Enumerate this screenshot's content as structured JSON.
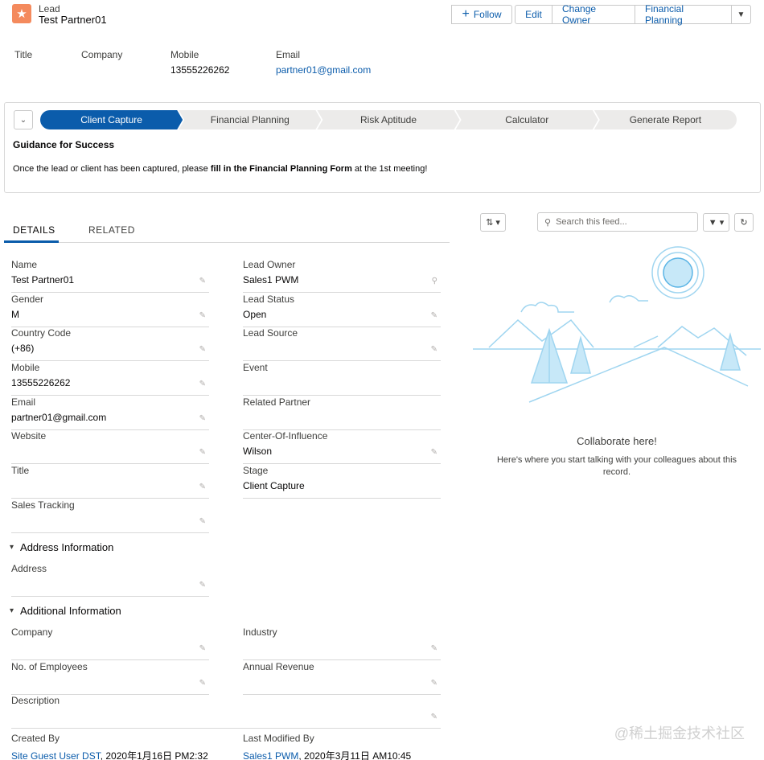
{
  "header": {
    "object_type": "Lead",
    "record_name": "Test Partner01",
    "buttons": {
      "follow": "Follow",
      "edit": "Edit",
      "change_owner": "Change Owner",
      "financial_planning": "Financial Planning"
    },
    "fields": [
      {
        "label": "Title",
        "value": ""
      },
      {
        "label": "Company",
        "value": ""
      },
      {
        "label": "Mobile",
        "value": "13555226262"
      },
      {
        "label": "Email",
        "value": "partner01@gmail.com"
      }
    ]
  },
  "path": {
    "stages": [
      "Client Capture",
      "Financial Planning",
      "Risk Aptitude",
      "Calculator",
      "Generate Report"
    ],
    "active_stage": "Client Capture",
    "guidance_title": "Guidance for Success",
    "guidance_text_start": "Once the lead or client has been captured, please ",
    "guidance_text_bold": "fill in the Financial Planning Form",
    "guidance_text_end": " at the 1st meeting!"
  },
  "tabs": {
    "details": "DETAILS",
    "related": "RELATED"
  },
  "details": {
    "left": [
      {
        "label": "Name",
        "value": "Test Partner01"
      },
      {
        "label": "Gender",
        "value": "M"
      },
      {
        "label": "Country Code",
        "value": "(+86)"
      },
      {
        "label": "Mobile",
        "value": "13555226262"
      },
      {
        "label": "Email",
        "value": "partner01@gmail.com"
      },
      {
        "label": "Website",
        "value": ""
      },
      {
        "label": "Title",
        "value": ""
      },
      {
        "label": "Sales Tracking",
        "value": ""
      }
    ],
    "right": [
      {
        "label": "Lead Owner",
        "value": "Sales1 PWM"
      },
      {
        "label": "Lead Status",
        "value": "Open"
      },
      {
        "label": "Lead Source",
        "value": ""
      },
      {
        "label": "Event",
        "value": ""
      },
      {
        "label": "Related Partner",
        "value": ""
      },
      {
        "label": "Center-Of-Influence",
        "value": "Wilson"
      },
      {
        "label": "Stage",
        "value": "Client Capture"
      }
    ],
    "address_section": {
      "title": "Address Information",
      "field_label": "Address",
      "field_value": ""
    },
    "additional_section": {
      "title": "Additional Information",
      "fields": [
        {
          "label": "Company",
          "value": ""
        },
        {
          "label": "Industry",
          "value": ""
        },
        {
          "label": "No. of Employees",
          "value": ""
        },
        {
          "label": "Annual Revenue",
          "value": ""
        },
        {
          "label": "Description",
          "value": ""
        }
      ]
    },
    "created_by": {
      "label": "Created By",
      "user": "Site Guest User DST",
      "date": ", 2020年1月16日 PM2:32"
    },
    "last_modified_by": {
      "label": "Last Modified By",
      "user": "Sales1 PWM",
      "date": ", 2020年3月11日 AM10:45"
    }
  },
  "feed": {
    "search_placeholder": "Search this feed...",
    "empty_title": "Collaborate here!",
    "empty_text": "Here's where you start talking with your colleagues about this record."
  },
  "watermark": "@稀土掘金技术社区",
  "colors": {
    "brand": "#0b5cab",
    "lead_icon": "#f48a5d",
    "path_inactive": "#ecebea"
  }
}
